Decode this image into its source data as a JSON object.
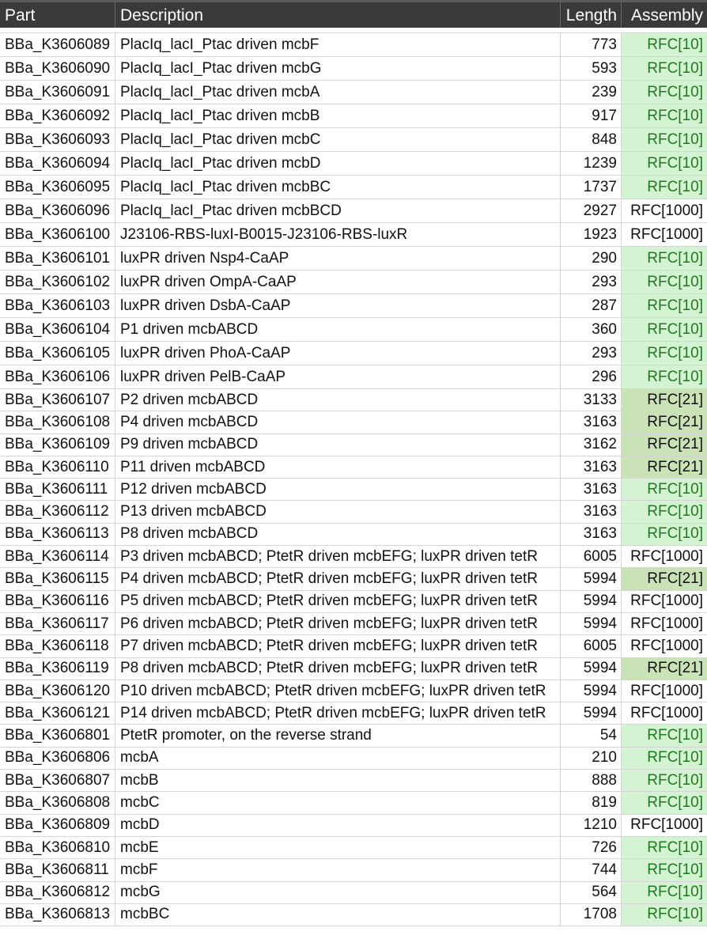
{
  "header": {
    "part": "Part",
    "description": "Description",
    "length": "Length",
    "assembly": "Assembly"
  },
  "rows": [
    {
      "part": "BBa_K3606089",
      "description": "PlacIq_lacI_Ptac driven mcbF",
      "length": "773",
      "assembly": "RFC[10]"
    },
    {
      "part": "BBa_K3606090",
      "description": "PlacIq_lacI_Ptac driven mcbG",
      "length": "593",
      "assembly": "RFC[10]"
    },
    {
      "part": "BBa_K3606091",
      "description": "PlacIq_lacI_Ptac driven mcbA",
      "length": "239",
      "assembly": "RFC[10]"
    },
    {
      "part": "BBa_K3606092",
      "description": "PlacIq_lacI_Ptac driven mcbB",
      "length": "917",
      "assembly": "RFC[10]"
    },
    {
      "part": "BBa_K3606093",
      "description": "PlacIq_lacI_Ptac driven mcbC",
      "length": "848",
      "assembly": "RFC[10]"
    },
    {
      "part": "BBa_K3606094",
      "description": "PlacIq_lacI_Ptac driven mcbD",
      "length": "1239",
      "assembly": "RFC[10]"
    },
    {
      "part": "BBa_K3606095",
      "description": "PlacIq_lacI_Ptac driven mcbBC",
      "length": "1737",
      "assembly": "RFC[10]"
    },
    {
      "part": "BBa_K3606096",
      "description": "PlacIq_lacI_Ptac driven mcbBCD",
      "length": "2927",
      "assembly": "RFC[1000]"
    },
    {
      "part": "BBa_K3606100",
      "description": "J23106-RBS-luxI-B0015-J23106-RBS-luxR",
      "length": "1923",
      "assembly": "RFC[1000]"
    },
    {
      "part": "BBa_K3606101",
      "description": "luxPR driven Nsp4-CaAP",
      "length": "290",
      "assembly": "RFC[10]"
    },
    {
      "part": "BBa_K3606102",
      "description": "luxPR driven OmpA-CaAP",
      "length": "293",
      "assembly": "RFC[10]"
    },
    {
      "part": "BBa_K3606103",
      "description": "luxPR driven DsbA-CaAP",
      "length": "287",
      "assembly": "RFC[10]"
    },
    {
      "part": "BBa_K3606104",
      "description": "P1 driven mcbABCD",
      "length": "360",
      "assembly": "RFC[10]"
    },
    {
      "part": "BBa_K3606105",
      "description": "luxPR driven PhoA-CaAP",
      "length": "293",
      "assembly": "RFC[10]"
    },
    {
      "part": "BBa_K3606106",
      "description": "luxPR driven PelB-CaAP",
      "length": "296",
      "assembly": "RFC[10]"
    },
    {
      "part": "BBa_K3606107",
      "description": "P2 driven mcbABCD",
      "length": "3133",
      "assembly": "RFC[21]"
    },
    {
      "part": "BBa_K3606108",
      "description": "P4 driven mcbABCD",
      "length": "3163",
      "assembly": "RFC[21]"
    },
    {
      "part": "BBa_K3606109",
      "description": "P9 driven mcbABCD",
      "length": "3162",
      "assembly": "RFC[21]"
    },
    {
      "part": "BBa_K3606110",
      "description": "P11 driven mcbABCD",
      "length": "3163",
      "assembly": "RFC[21]"
    },
    {
      "part": "BBa_K3606111",
      "description": "P12 driven mcbABCD",
      "length": "3163",
      "assembly": "RFC[10]"
    },
    {
      "part": "BBa_K3606112",
      "description": "P13 driven mcbABCD",
      "length": "3163",
      "assembly": "RFC[10]"
    },
    {
      "part": "BBa_K3606113",
      "description": "P8 driven mcbABCD",
      "length": "3163",
      "assembly": "RFC[10]"
    },
    {
      "part": "BBa_K3606114",
      "description": "P3 driven mcbABCD; PtetR driven mcbEFG; luxPR driven tetR",
      "length": "6005",
      "assembly": "RFC[1000]"
    },
    {
      "part": "BBa_K3606115",
      "description": "P4 driven mcbABCD; PtetR driven mcbEFG; luxPR driven tetR",
      "length": "5994",
      "assembly": "RFC[21]"
    },
    {
      "part": "BBa_K3606116",
      "description": "P5 driven mcbABCD; PtetR driven mcbEFG; luxPR driven tetR",
      "length": "5994",
      "assembly": "RFC[1000]"
    },
    {
      "part": "BBa_K3606117",
      "description": "P6 driven mcbABCD; PtetR driven mcbEFG; luxPR driven tetR",
      "length": "5994",
      "assembly": "RFC[1000]"
    },
    {
      "part": "BBa_K3606118",
      "description": "P7 driven mcbABCD; PtetR driven mcbEFG; luxPR driven tetR",
      "length": "6005",
      "assembly": "RFC[1000]"
    },
    {
      "part": "BBa_K3606119",
      "description": "P8 driven mcbABCD; PtetR driven mcbEFG; luxPR driven tetR",
      "length": "5994",
      "assembly": "RFC[21]"
    },
    {
      "part": "BBa_K3606120",
      "description": "P10 driven mcbABCD; PtetR driven mcbEFG; luxPR driven tetR",
      "length": "5994",
      "assembly": "RFC[1000]"
    },
    {
      "part": "BBa_K3606121",
      "description": "P14 driven mcbABCD; PtetR driven mcbEFG; luxPR driven tetR",
      "length": "5994",
      "assembly": "RFC[1000]"
    },
    {
      "part": "BBa_K3606801",
      "description": "PtetR promoter, on the reverse strand",
      "length": "54",
      "assembly": "RFC[10]"
    },
    {
      "part": "BBa_K3606806",
      "description": "mcbA",
      "length": "210",
      "assembly": "RFC[10]"
    },
    {
      "part": "BBa_K3606807",
      "description": "mcbB",
      "length": "888",
      "assembly": "RFC[10]"
    },
    {
      "part": "BBa_K3606808",
      "description": "mcbC",
      "length": "819",
      "assembly": "RFC[10]"
    },
    {
      "part": "BBa_K3606809",
      "description": "mcbD",
      "length": "1210",
      "assembly": "RFC[1000]"
    },
    {
      "part": "BBa_K3606810",
      "description": "mcbE",
      "length": "726",
      "assembly": "RFC[10]"
    },
    {
      "part": "BBa_K3606811",
      "description": "mcbF",
      "length": "744",
      "assembly": "RFC[10]"
    },
    {
      "part": "BBa_K3606812",
      "description": "mcbG",
      "length": "564",
      "assembly": "RFC[10]"
    },
    {
      "part": "BBa_K3606813",
      "description": "mcbBC",
      "length": "1708",
      "assembly": "RFC[10]"
    }
  ],
  "colors": {
    "header_bg": "#3a3a3a",
    "rfc10_bg": "#d4f3d2",
    "rfc10_text": "#1e7a1e",
    "rfc21_bg": "#c9e3b6",
    "rfc1000_bg": "#ffffff"
  }
}
